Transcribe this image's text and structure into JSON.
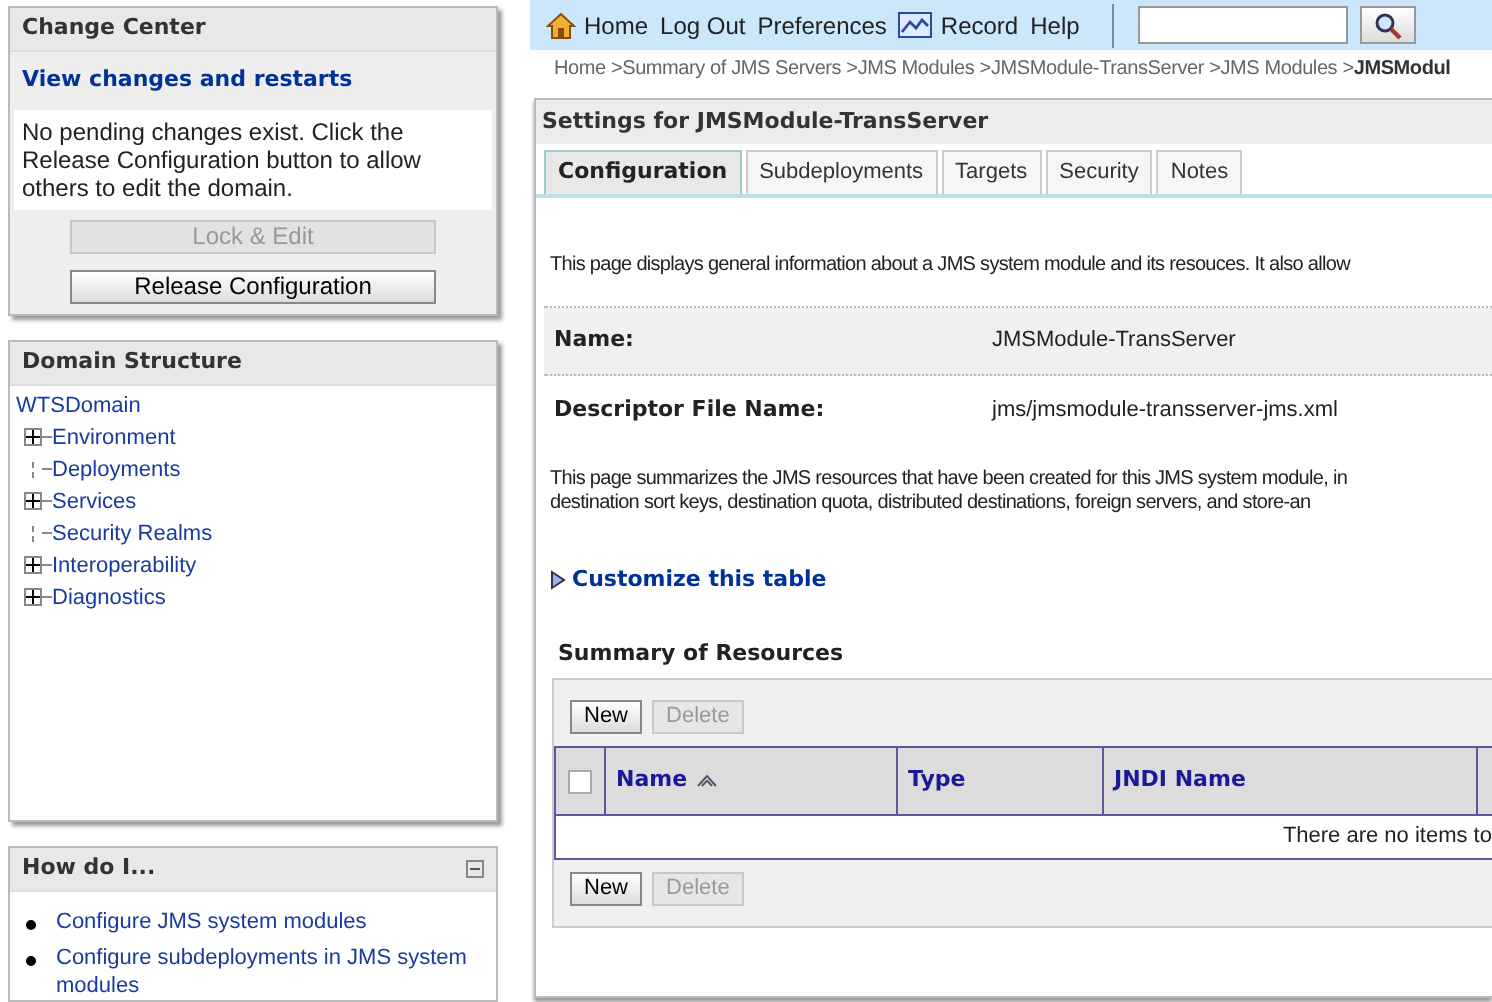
{
  "change_center": {
    "title": "Change Center",
    "link": "View changes and restarts",
    "message": "No pending changes exist. Click the Release Configuration button to allow others to edit the domain.",
    "buttons": [
      {
        "label": "Lock & Edit",
        "disabled": true
      },
      {
        "label": "Release Configuration",
        "disabled": false
      }
    ]
  },
  "domain_structure": {
    "title": "Domain Structure",
    "root": "WTSDomain",
    "items": [
      {
        "label": "Environment",
        "kind": "expandable"
      },
      {
        "label": "Deployments",
        "kind": "leaf"
      },
      {
        "label": "Services",
        "kind": "expandable"
      },
      {
        "label": "Security Realms",
        "kind": "leaf"
      },
      {
        "label": "Interoperability",
        "kind": "expandable"
      },
      {
        "label": "Diagnostics",
        "kind": "expandable"
      }
    ]
  },
  "how_do_i": {
    "title": "How do I...",
    "links": [
      "Configure JMS system modules",
      "Configure subdeployments in JMS system modules"
    ]
  },
  "toolbar": {
    "links": [
      {
        "label": "Home"
      },
      {
        "label": "Log Out"
      },
      {
        "label": "Preferences"
      },
      {
        "label": "Record"
      },
      {
        "label": "Help"
      }
    ]
  },
  "breadcrumb": [
    {
      "label": "Home >",
      "current": false
    },
    {
      "label": "Summary of JMS Servers >",
      "current": false
    },
    {
      "label": "JMS Modules >",
      "current": false
    },
    {
      "label": "JMSModule-TransServer >",
      "current": false
    },
    {
      "label": "JMS Modules >",
      "current": false
    },
    {
      "label": "JMSModul",
      "current": true
    }
  ],
  "settings": {
    "title": "Settings for JMSModule-TransServer",
    "tabs": [
      {
        "label": "Configuration",
        "selected": true
      },
      {
        "label": "Subdeployments",
        "selected": false
      },
      {
        "label": "Targets",
        "selected": false
      },
      {
        "label": "Security",
        "selected": false
      },
      {
        "label": "Notes",
        "selected": false
      }
    ],
    "intro": "This page displays general information about a JMS system module and its resouces. It also allow",
    "fields": [
      {
        "label": "Name:",
        "value": "JMSModule-TransServer"
      },
      {
        "label": "Descriptor File Name:",
        "value": "jms/jmsmodule-transserver-jms.xml"
      }
    ],
    "summary_lines": [
      "This page summarizes the JMS resources that have been created for this JMS system module, in",
      "destination sort keys, destination quota, distributed destinations, foreign servers, and store-an"
    ],
    "customize_link": "Customize this table",
    "table": {
      "title": "Summary of Resources",
      "buttons": [
        {
          "label": "New",
          "disabled": false
        },
        {
          "label": "Delete",
          "disabled": true
        }
      ],
      "select_all": false,
      "columns": [
        {
          "label": "Name",
          "sorted": true
        },
        {
          "label": "Type",
          "sorted": false
        },
        {
          "label": "JNDI Name",
          "sorted": false
        }
      ],
      "empty_message": "There are no items to",
      "bottom_buttons": [
        {
          "label": "New",
          "disabled": false
        },
        {
          "label": "Delete",
          "disabled": true
        }
      ]
    }
  }
}
